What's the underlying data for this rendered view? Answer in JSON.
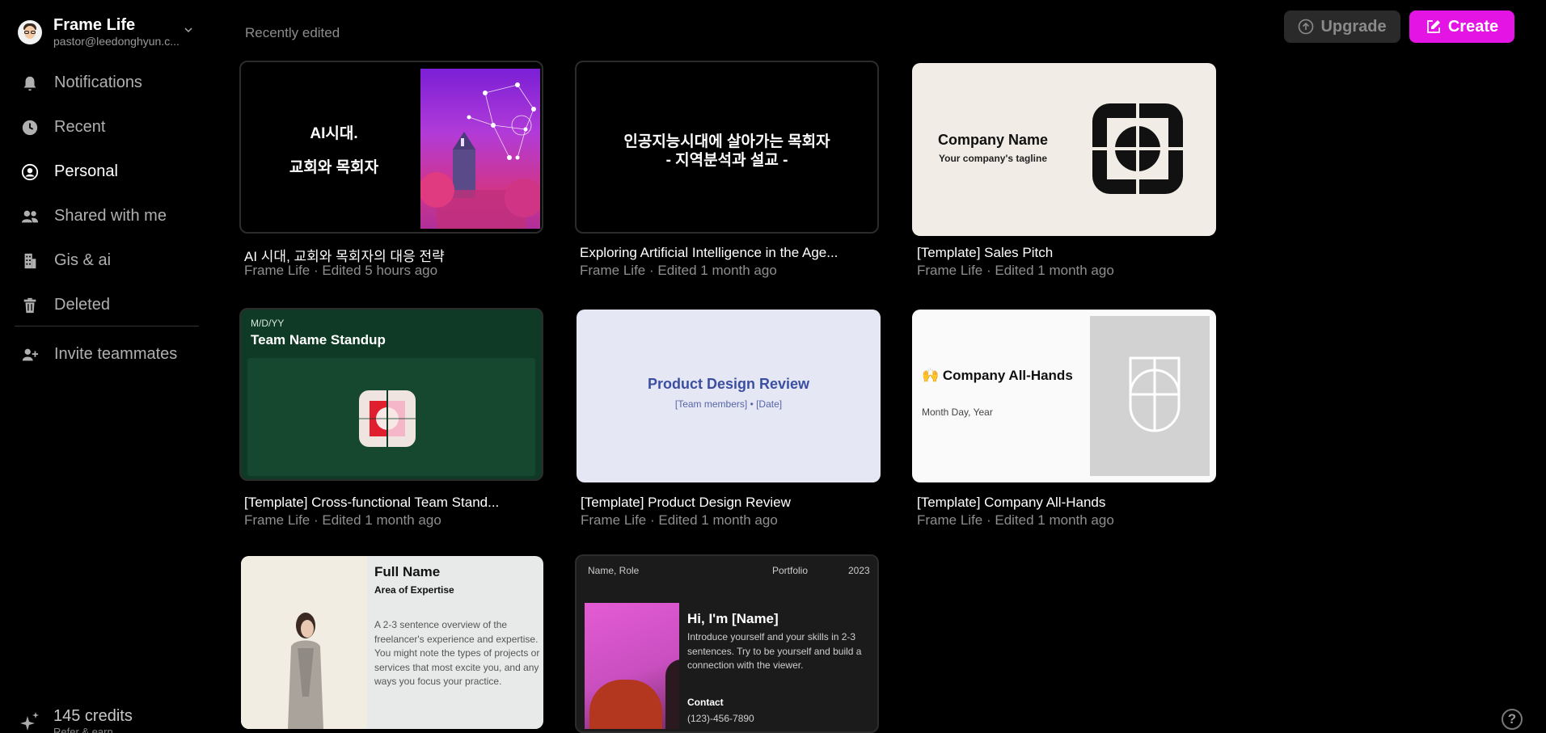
{
  "account": {
    "name": "Frame Life",
    "email": "pastor@leedonghyun.c..."
  },
  "nav": {
    "items": [
      {
        "label": "Notifications",
        "icon": "bell-icon"
      },
      {
        "label": "Recent",
        "icon": "clock-icon"
      },
      {
        "label": "Personal",
        "icon": "user-circle-icon"
      },
      {
        "label": "Shared with me",
        "icon": "users-icon"
      },
      {
        "label": "Gis & ai",
        "icon": "building-icon"
      },
      {
        "label": "Deleted",
        "icon": "trash-icon"
      }
    ],
    "active": "Personal",
    "invite": "Invite teammates"
  },
  "credits": {
    "count": "145 credits",
    "sub": "Refer & earn"
  },
  "header": {
    "section_title": "Recently edited",
    "upgrade_label": "Upgrade",
    "create_label": "Create"
  },
  "help_label": "?",
  "colors": {
    "accent": "#e414e4",
    "background": "#000000"
  },
  "cards": [
    {
      "title": "AI 시대, 교회와 목회자의 대응 전략",
      "meta": "Frame Life · Edited 5 hours ago",
      "thumb": {
        "line1": "AI시대.",
        "line2": "교회와 목회자"
      }
    },
    {
      "title": "Exploring Artificial Intelligence in the Age...",
      "meta": "Frame Life · Edited 1 month ago",
      "thumb": {
        "line1": "인공지능시대에 살아가는 목회자",
        "line2": "- 지역분석과 설교 -"
      }
    },
    {
      "title": "[Template] Sales Pitch",
      "meta": "Frame Life · Edited 1 month ago",
      "thumb": {
        "name": "Company Name",
        "tagline": "Your company's tagline"
      }
    },
    {
      "title": "[Template] Cross-functional Team Stand...",
      "meta": "Frame Life · Edited 1 month ago",
      "thumb": {
        "date": "M/D/YY",
        "name": "Team Name Standup"
      }
    },
    {
      "title": "[Template] Product Design Review",
      "meta": "Frame Life · Edited 1 month ago",
      "thumb": {
        "name": "Product Design Review",
        "sub": "[Team members] • [Date]"
      }
    },
    {
      "title": "[Template] Company All-Hands",
      "meta": "Frame Life · Edited 1 month ago",
      "thumb": {
        "name": "🙌 Company All-Hands",
        "date": "Month Day, Year"
      }
    },
    {
      "thumb": {
        "name": "Full Name",
        "area": "Area of Expertise",
        "desc": "A 2-3 sentence overview of the freelancer's experience and expertise. You might note the types of projects or services that most excite you, and any ways you focus your practice."
      }
    },
    {
      "thumb": {
        "role": "Name, Role",
        "portfolio": "Portfolio",
        "year": "2023",
        "hi": "Hi, I'm [Name]",
        "intro": "Introduce yourself and your skills in 2-3 sentences. Try to be yourself and build a connection with the viewer.",
        "contact": "Contact",
        "phone": "(123)-456-7890"
      }
    }
  ]
}
